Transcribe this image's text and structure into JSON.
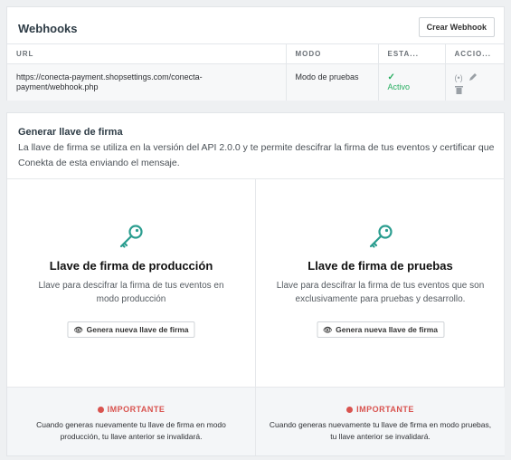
{
  "colors": {
    "accent": "#2a9d8f",
    "success": "#27ae60",
    "danger": "#d9534f"
  },
  "webhooks": {
    "title": "Webhooks",
    "create_button": "Crear Webhook",
    "columns": [
      "URL",
      "MODO",
      "ESTA...",
      "ACCIO..."
    ],
    "rows": [
      {
        "url": "https://conecta-payment.shopsettings.com/conecta-payment/webhook.php",
        "mode": "Modo de pruebas",
        "status": "Activo",
        "status_icon": "check-icon",
        "actions": [
          "broadcast-icon",
          "pencil-icon",
          "trash-icon"
        ]
      }
    ]
  },
  "signing": {
    "title": "Generar llave de firma",
    "description": "La llave de firma se utiliza en la versión del API 2.0.0 y te permite descifrar la firma de tus eventos y certificar que Conekta de esta enviando el mensaje.",
    "production": {
      "icon": "key-icon",
      "title": "Llave de firma de producción",
      "description": "Llave para descifrar la firma de tus eventos en modo producción",
      "button": "Genera nueva llave de firma",
      "warning_title": "IMPORTANTE",
      "warning_text": "Cuando generas nuevamente tu llave de firma en modo producción, tu llave anterior se invalidará."
    },
    "testing": {
      "icon": "key-icon",
      "title": "Llave de firma de pruebas",
      "description": "Llave para descifrar la firma de tus eventos que son exclusivamente para pruebas y desarrollo.",
      "button": "Genera nueva llave de firma",
      "warning_title": "IMPORTANTE",
      "warning_text": "Cuando generas nuevamente tu llave de firma en modo pruebas, tu llave anterior se invalidará."
    }
  }
}
